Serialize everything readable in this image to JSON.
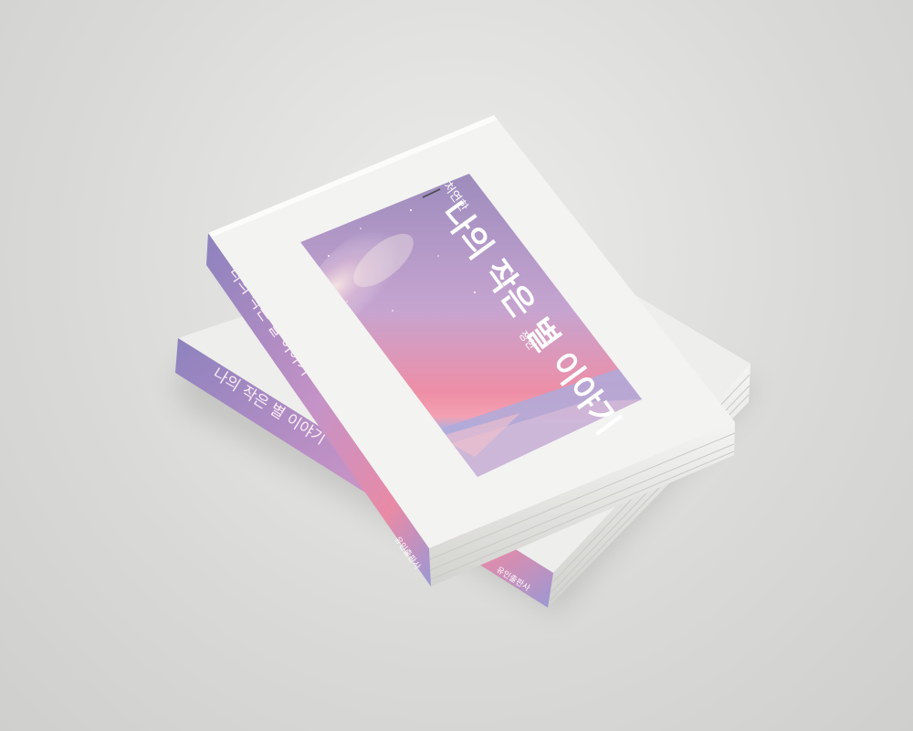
{
  "book": {
    "subtitle": "처연한",
    "title": "나의 작은 별 이야기",
    "author": "장한",
    "spine_title": "나의 작은 별 이야기",
    "publisher": "유인출판사"
  },
  "colors": {
    "background": "#dcdcda",
    "cover_white": "#f2f2f0",
    "sky_top": "#a28fbf",
    "sky_mid": "#c4a2cf",
    "horizon_pink": "#ec8aa4",
    "ground_lavender": "#a9a7d8"
  }
}
